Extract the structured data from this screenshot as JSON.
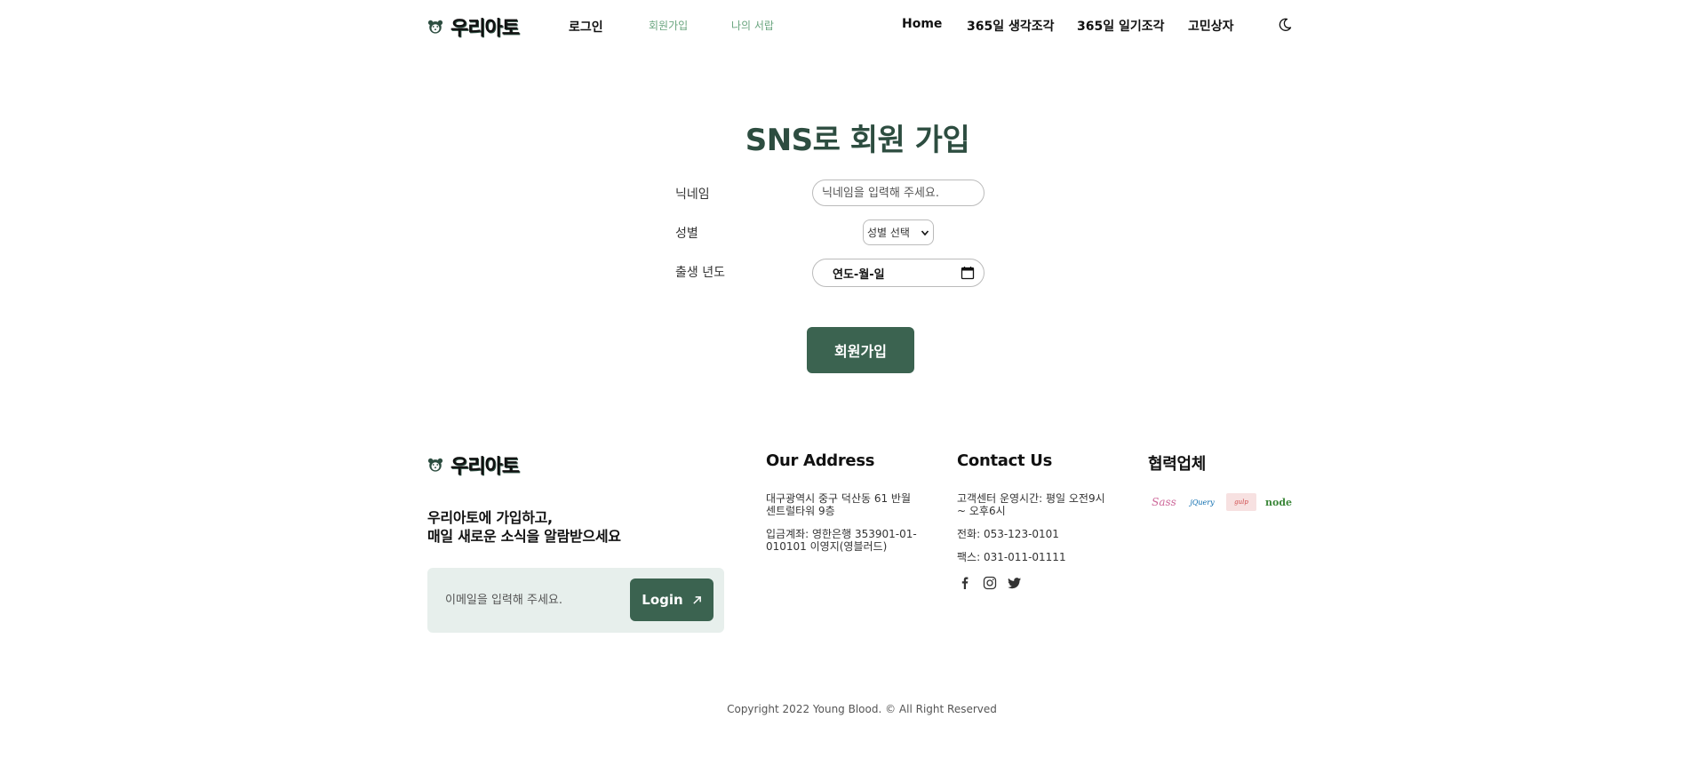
{
  "header": {
    "logo_text": "우리아토",
    "nav_left": {
      "login": "로그인",
      "join": "회원가입",
      "my_shelf": "나의 서랍"
    },
    "nav_right": {
      "home": "Home",
      "think": "365일 생각조각",
      "diary": "365일 일기조각",
      "worry": "고민상자"
    },
    "theme_icon": "moon-icon"
  },
  "signup": {
    "title": "SNS로 회원 가입",
    "nickname_label": "닉네임",
    "nickname_placeholder": "닉네임을 입력해 주세요.",
    "gender_label": "성별",
    "gender_selected": "성별 선택",
    "birth_label": "출생 년도",
    "birth_value": "연도-월-일",
    "submit_label": "회원가입"
  },
  "footer": {
    "logo_text": "우리아토",
    "tagline_line1": "우리아토에 가입하고,",
    "tagline_line2": "매일 새로운 소식을 알람받으세요",
    "email_placeholder": "이메일을 입력해 주세요.",
    "login_label": "Login",
    "address": {
      "heading": "Our Address",
      "line1": "대구광역시 중구 덕산동 61 반월센트럴타워 9층",
      "line2": "입금계좌: 영한은행 353901-01-010101 이영지(영블러드)"
    },
    "contact": {
      "heading": "Contact Us",
      "hours": "고객센터 운영시간: 평일 오전9시 ~ 오후6시",
      "tel": "전화: 053-123-0101",
      "fax": "팩스: 031-011-01111"
    },
    "partners": {
      "heading": "협력업체",
      "items": [
        "Sass",
        "jQuery",
        "gulp",
        "node"
      ]
    },
    "copyright": "Copyright 2022 Young Blood. © All Right Reserved"
  },
  "colors": {
    "brand_green": "#3b6350",
    "title_green": "#2d4d40",
    "light_green_link": "#6aa57f",
    "subscribe_bg": "#e7efec"
  }
}
